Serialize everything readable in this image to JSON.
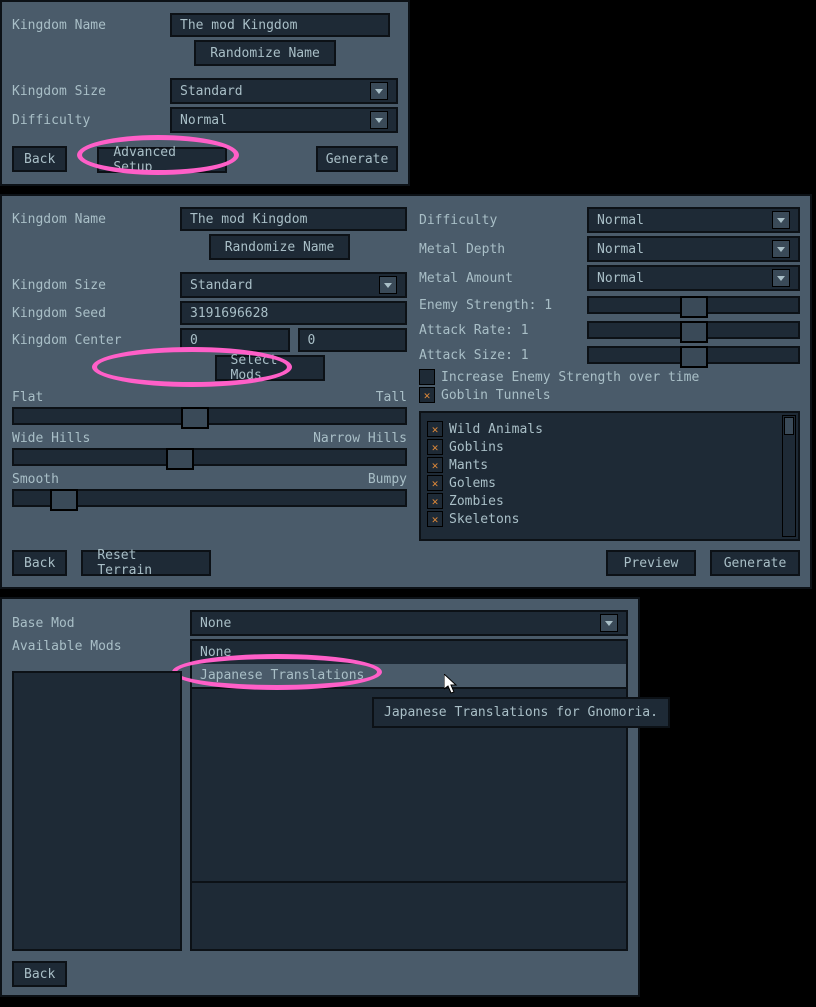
{
  "top_panel": {
    "kingdom_name_label": "Kingdom Name",
    "kingdom_name_value": "The mod Kingdom",
    "randomize_name": "Randomize Name",
    "kingdom_size_label": "Kingdom Size",
    "kingdom_size_value": "Standard",
    "difficulty_label": "Difficulty",
    "difficulty_value": "Normal",
    "back": "Back",
    "advanced_setup": "Advanced Setup",
    "generate": "Generate"
  },
  "mid_panel": {
    "left": {
      "kingdom_name_label": "Kingdom Name",
      "kingdom_name_value": "The mod Kingdom",
      "randomize_name": "Randomize Name",
      "kingdom_size_label": "Kingdom Size",
      "kingdom_size_value": "Standard",
      "kingdom_seed_label": "Kingdom Seed",
      "kingdom_seed_value": "3191696628",
      "kingdom_center_label": "Kingdom Center",
      "kingdom_center_x": "0",
      "kingdom_center_y": "0",
      "select_mods": "Select Mods",
      "slider1_left": "Flat",
      "slider1_right": "Tall",
      "slider1_pos": 0.46,
      "slider2_left": "Wide Hills",
      "slider2_right": "Narrow Hills",
      "slider2_pos": 0.42,
      "slider3_left": "Smooth",
      "slider3_right": "Bumpy",
      "slider3_pos": 0.1,
      "back": "Back",
      "reset_terrain": "Reset Terrain"
    },
    "right": {
      "difficulty_label": "Difficulty",
      "difficulty_value": "Normal",
      "metal_depth_label": "Metal Depth",
      "metal_depth_value": "Normal",
      "metal_amount_label": "Metal Amount",
      "metal_amount_value": "Normal",
      "enemy_strength_label": "Enemy Strength: 1",
      "enemy_strength_pos": 0.5,
      "attack_rate_label": "Attack Rate: 1",
      "attack_rate_pos": 0.5,
      "attack_size_label": "Attack Size: 1",
      "attack_size_pos": 0.5,
      "increase_label": "Increase Enemy Strength over time",
      "increase_checked": false,
      "goblin_tunnels_label": "Goblin Tunnels",
      "goblin_tunnels_checked": true,
      "enemies": [
        {
          "label": "Wild Animals",
          "checked": true
        },
        {
          "label": "Goblins",
          "checked": true
        },
        {
          "label": "Mants",
          "checked": true
        },
        {
          "label": "Golems",
          "checked": true
        },
        {
          "label": "Zombies",
          "checked": true
        },
        {
          "label": "Skeletons",
          "checked": true
        }
      ],
      "preview": "Preview",
      "generate": "Generate"
    }
  },
  "bottom_panel": {
    "base_mod_label": "Base Mod",
    "base_mod_value": "None",
    "available_mods_label": "Available Mods",
    "dropdown_options": [
      "None",
      "Japanese Translations"
    ],
    "tooltip": "Japanese Translations for Gnomoria.",
    "back": "Back"
  }
}
